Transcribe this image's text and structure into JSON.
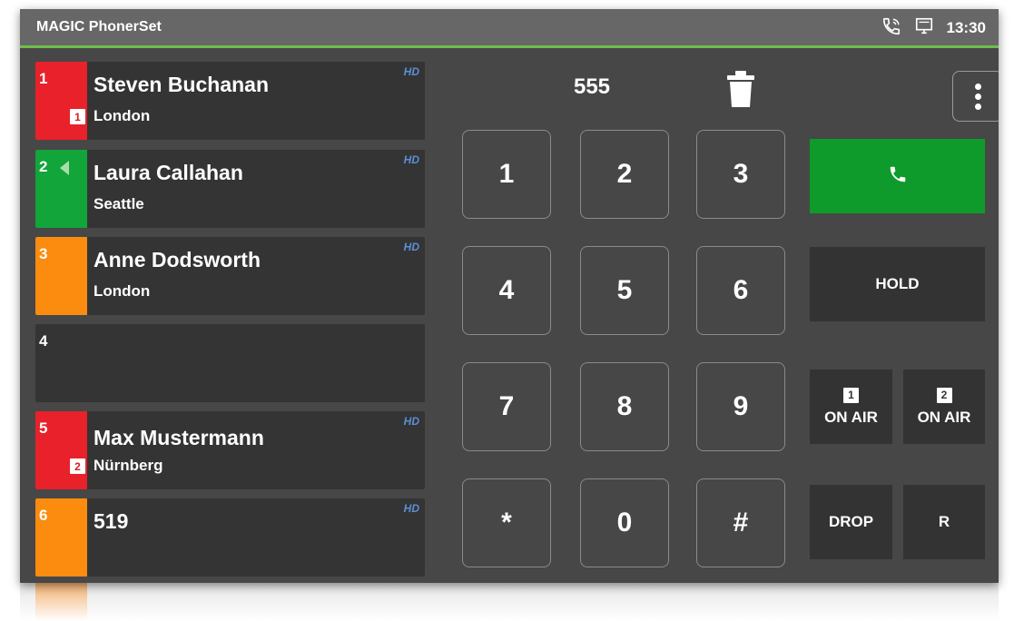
{
  "app": {
    "title": "MAGIC PhonerSet",
    "clock": "13:30"
  },
  "colors": {
    "red": "#e8212b",
    "green": "#12a53a",
    "orange": "#fb8c0f",
    "accent": "#6cc04a",
    "call": "#0e9b2b"
  },
  "lines": [
    {
      "number": "1",
      "name": "Steven Buchanan",
      "city": "London",
      "hd": "HD",
      "studio": "1",
      "color": "#e8212b"
    },
    {
      "number": "2",
      "name": "Laura Callahan",
      "city": "Seattle",
      "hd": "HD",
      "color": "#12a53a"
    },
    {
      "number": "3",
      "name": "Anne Dodsworth",
      "city": "London",
      "hd": "HD",
      "color": "#fb8c0f"
    },
    {
      "number": "4",
      "name": "",
      "city": "",
      "hd": "",
      "color": ""
    },
    {
      "number": "5",
      "name": "Max Mustermann",
      "city": "Nürnberg",
      "hd": "HD",
      "studio": "2",
      "color": "#e8212b"
    },
    {
      "number": "6",
      "name": "519",
      "city": "",
      "hd": "HD",
      "color": "#fb8c0f"
    }
  ],
  "dialer": {
    "number": "555",
    "keys": [
      "1",
      "2",
      "3",
      "4",
      "5",
      "6",
      "7",
      "8",
      "9",
      "*",
      "0",
      "#"
    ]
  },
  "buttons": {
    "hold": "HOLD",
    "drop": "DROP",
    "r": "R",
    "on_air_1_badge": "1",
    "on_air_1": "ON AIR",
    "on_air_2_badge": "2",
    "on_air_2": "ON AIR"
  },
  "icons": {
    "status": [
      "phone-call-icon",
      "desktop-icon"
    ],
    "trash": "trash-icon",
    "menu": "more-vertical-icon",
    "call": "phone-icon"
  }
}
